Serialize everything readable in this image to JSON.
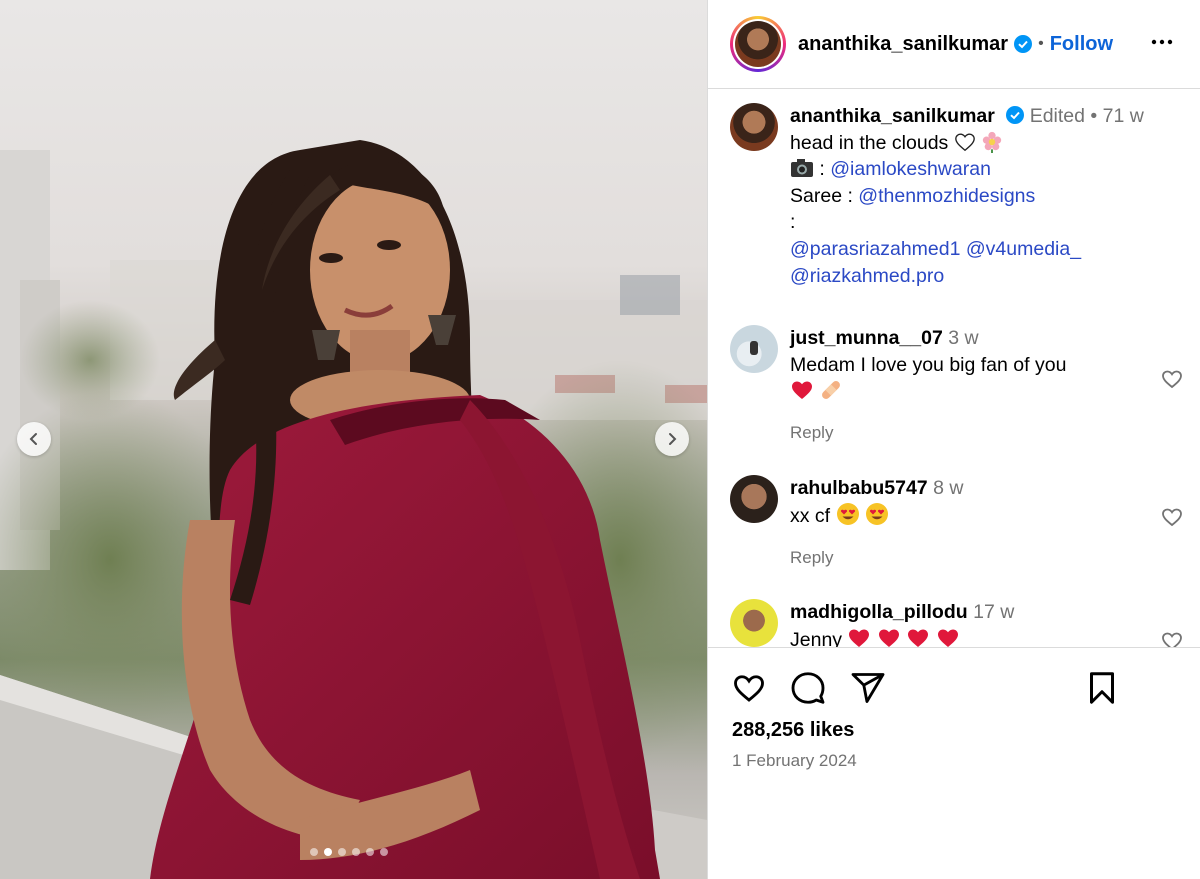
{
  "photo": {
    "alt_image": "woman in red saree on rooftop",
    "carousel_dots": 6,
    "active_dot_index": 1
  },
  "header": {
    "username": "ananthika_sanilkumar",
    "separator": "•",
    "follow_label": "Follow"
  },
  "caption": {
    "username": "ananthika_sanilkumar",
    "edited": "Edited",
    "dot": "•",
    "age": "71 w",
    "line1": "head in the clouds",
    "camera_sep": ":",
    "photographer": "@iamlokeshwaran",
    "saree_label": "Saree :",
    "saree_tag": "@thenmozhidesigns",
    "colon_line": ":",
    "tag1": "@parasriazahmed1",
    "tag2": "@v4umedia_",
    "tag3": "@riazkahmed.pro"
  },
  "comments": [
    {
      "username": "just_munna__07",
      "age": "3 w",
      "text": "Medam I love you big fan of you",
      "reply": "Reply"
    },
    {
      "username": "rahulbabu5747",
      "age": "8 w",
      "text": "xx cf",
      "reply": "Reply"
    },
    {
      "username": "madhigolla_pillodu",
      "age": "17 w",
      "text": "Jenny"
    }
  ],
  "footer": {
    "likes": "288,256 likes",
    "date": "1 February 2024"
  },
  "colors": {
    "link": "#2b49c5",
    "follow": "#0d64d8",
    "verified": "#0095f6",
    "heart": "#e0245e"
  }
}
